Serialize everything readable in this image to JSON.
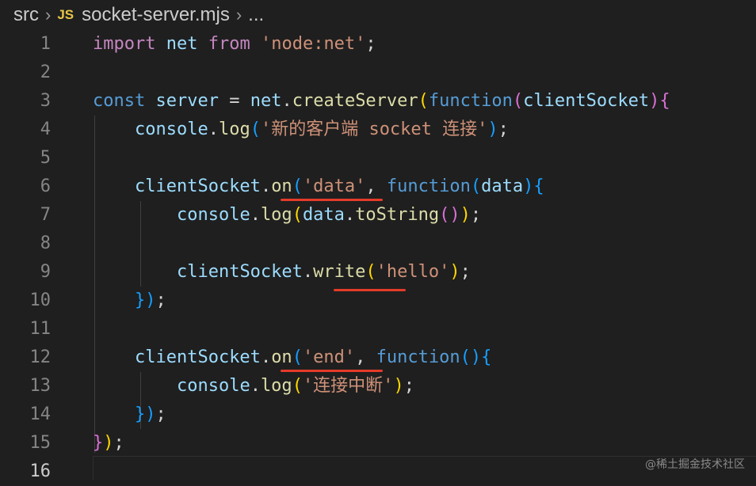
{
  "breadcrumb": {
    "folder": "src",
    "file_icon": "JS",
    "file": "socket-server.mjs",
    "more": "..."
  },
  "editor": {
    "line_numbers": [
      "1",
      "2",
      "3",
      "4",
      "5",
      "6",
      "7",
      "8",
      "9",
      "10",
      "11",
      "12",
      "13",
      "14",
      "15",
      "16"
    ],
    "active_line": "16",
    "lines": [
      [
        [
          "k",
          "import"
        ],
        [
          "p",
          " "
        ],
        [
          "v",
          "net"
        ],
        [
          "p",
          " "
        ],
        [
          "k",
          "from"
        ],
        [
          "p",
          " "
        ],
        [
          "s",
          "'node:net'"
        ],
        [
          "p",
          ";"
        ]
      ],
      [],
      [
        [
          "b",
          "const"
        ],
        [
          "p",
          " "
        ],
        [
          "v",
          "server"
        ],
        [
          "p",
          " = "
        ],
        [
          "v",
          "net"
        ],
        [
          "p",
          "."
        ],
        [
          "f",
          "createServer"
        ],
        [
          "y",
          "("
        ],
        [
          "b",
          "function"
        ],
        [
          "m",
          "("
        ],
        [
          "v",
          "clientSocket"
        ],
        [
          "m",
          ")"
        ],
        [
          "m",
          "{"
        ]
      ],
      [
        [
          "p",
          "    "
        ],
        [
          "v",
          "console"
        ],
        [
          "p",
          "."
        ],
        [
          "f",
          "log"
        ],
        [
          "c",
          "("
        ],
        [
          "s",
          "'新的客户端 socket 连接'"
        ],
        [
          "c",
          ")"
        ],
        [
          "p",
          ";"
        ]
      ],
      [],
      [
        [
          "p",
          "    "
        ],
        [
          "v",
          "clientSocket"
        ],
        [
          "p",
          "."
        ],
        [
          "f",
          "on"
        ],
        [
          "c",
          "("
        ],
        [
          "s",
          "'data'"
        ],
        [
          "p",
          ", "
        ],
        [
          "b",
          "function"
        ],
        [
          "c",
          "("
        ],
        [
          "v",
          "data"
        ],
        [
          "c",
          ")"
        ],
        [
          "c",
          "{"
        ]
      ],
      [
        [
          "p",
          "        "
        ],
        [
          "v",
          "console"
        ],
        [
          "p",
          "."
        ],
        [
          "f",
          "log"
        ],
        [
          "y",
          "("
        ],
        [
          "v",
          "data"
        ],
        [
          "p",
          "."
        ],
        [
          "f",
          "toString"
        ],
        [
          "m",
          "()"
        ],
        [
          "y",
          ")"
        ],
        [
          "p",
          ";"
        ]
      ],
      [],
      [
        [
          "p",
          "        "
        ],
        [
          "v",
          "clientSocket"
        ],
        [
          "p",
          "."
        ],
        [
          "f",
          "write"
        ],
        [
          "y",
          "("
        ],
        [
          "s",
          "'hello'"
        ],
        [
          "y",
          ")"
        ],
        [
          "p",
          ";"
        ]
      ],
      [
        [
          "p",
          "    "
        ],
        [
          "c",
          "}"
        ],
        [
          "c",
          ")"
        ],
        [
          "p",
          ";"
        ]
      ],
      [],
      [
        [
          "p",
          "    "
        ],
        [
          "v",
          "clientSocket"
        ],
        [
          "p",
          "."
        ],
        [
          "f",
          "on"
        ],
        [
          "c",
          "("
        ],
        [
          "s",
          "'end'"
        ],
        [
          "p",
          ", "
        ],
        [
          "b",
          "function"
        ],
        [
          "c",
          "()"
        ],
        [
          "c",
          "{"
        ]
      ],
      [
        [
          "p",
          "        "
        ],
        [
          "v",
          "console"
        ],
        [
          "p",
          "."
        ],
        [
          "f",
          "log"
        ],
        [
          "y",
          "("
        ],
        [
          "s",
          "'连接中断'"
        ],
        [
          "y",
          ")"
        ],
        [
          "p",
          ";"
        ]
      ],
      [
        [
          "p",
          "    "
        ],
        [
          "c",
          "}"
        ],
        [
          "c",
          ")"
        ],
        [
          "p",
          ";"
        ]
      ],
      [
        [
          "m",
          "}"
        ],
        [
          "y",
          ")"
        ],
        [
          "p",
          ";"
        ]
      ],
      []
    ]
  },
  "annotations": {
    "color": "#e53b2a",
    "underlined_calls": [
      "on('data'",
      "write",
      "on('end'"
    ]
  },
  "watermark": "@稀土掘金技术社区"
}
